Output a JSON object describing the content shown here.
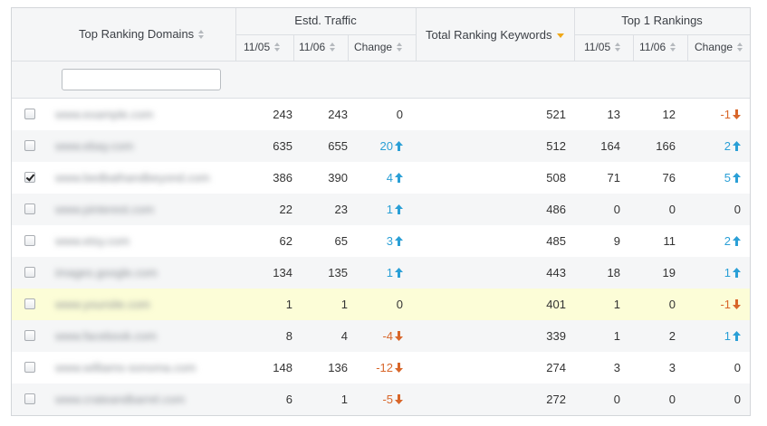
{
  "columns": {
    "domain": "Top Ranking Domains",
    "traffic_group": "Estd. Traffic",
    "traffic_d1": "11/05",
    "traffic_d2": "11/06",
    "traffic_change": "Change",
    "total_keywords": "Total Ranking Keywords",
    "top1_group": "Top 1 Rankings",
    "top1_d1": "11/05",
    "top1_d2": "11/06",
    "top1_change": "Change"
  },
  "filter": {
    "value": "",
    "placeholder": ""
  },
  "colors": {
    "up": "#2a9fd6",
    "down": "#d8662a",
    "highlight": "#fcfdd7",
    "sort_active": "#f0a818"
  },
  "rows": [
    {
      "checked": false,
      "domain": "www.example.com",
      "t1": "243",
      "t2": "243",
      "tc": "0",
      "tdir": "none",
      "kw": "521",
      "r1": "13",
      "r2": "12",
      "rc": "-1",
      "rdir": "down",
      "highlight": false
    },
    {
      "checked": false,
      "domain": "www.ebay.com",
      "t1": "635",
      "t2": "655",
      "tc": "20",
      "tdir": "up",
      "kw": "512",
      "r1": "164",
      "r2": "166",
      "rc": "2",
      "rdir": "up",
      "highlight": false
    },
    {
      "checked": true,
      "domain": "www.bedbathandbeyond.com",
      "t1": "386",
      "t2": "390",
      "tc": "4",
      "tdir": "up",
      "kw": "508",
      "r1": "71",
      "r2": "76",
      "rc": "5",
      "rdir": "up",
      "highlight": false
    },
    {
      "checked": false,
      "domain": "www.pinterest.com",
      "t1": "22",
      "t2": "23",
      "tc": "1",
      "tdir": "up",
      "kw": "486",
      "r1": "0",
      "r2": "0",
      "rc": "0",
      "rdir": "none",
      "highlight": false
    },
    {
      "checked": false,
      "domain": "www.etsy.com",
      "t1": "62",
      "t2": "65",
      "tc": "3",
      "tdir": "up",
      "kw": "485",
      "r1": "9",
      "r2": "11",
      "rc": "2",
      "rdir": "up",
      "highlight": false
    },
    {
      "checked": false,
      "domain": "images.google.com",
      "t1": "134",
      "t2": "135",
      "tc": "1",
      "tdir": "up",
      "kw": "443",
      "r1": "18",
      "r2": "19",
      "rc": "1",
      "rdir": "up",
      "highlight": false
    },
    {
      "checked": false,
      "domain": "www.yoursite.com",
      "t1": "1",
      "t2": "1",
      "tc": "0",
      "tdir": "none",
      "kw": "401",
      "r1": "1",
      "r2": "0",
      "rc": "-1",
      "rdir": "down",
      "highlight": true
    },
    {
      "checked": false,
      "domain": "www.facebook.com",
      "t1": "8",
      "t2": "4",
      "tc": "-4",
      "tdir": "down",
      "kw": "339",
      "r1": "1",
      "r2": "2",
      "rc": "1",
      "rdir": "up",
      "highlight": false
    },
    {
      "checked": false,
      "domain": "www.williams-sonoma.com",
      "t1": "148",
      "t2": "136",
      "tc": "-12",
      "tdir": "down",
      "kw": "274",
      "r1": "3",
      "r2": "3",
      "rc": "0",
      "rdir": "none",
      "highlight": false
    },
    {
      "checked": false,
      "domain": "www.crateandbarrel.com",
      "t1": "6",
      "t2": "1",
      "tc": "-5",
      "tdir": "down",
      "kw": "272",
      "r1": "0",
      "r2": "0",
      "rc": "0",
      "rdir": "none",
      "highlight": false
    }
  ]
}
